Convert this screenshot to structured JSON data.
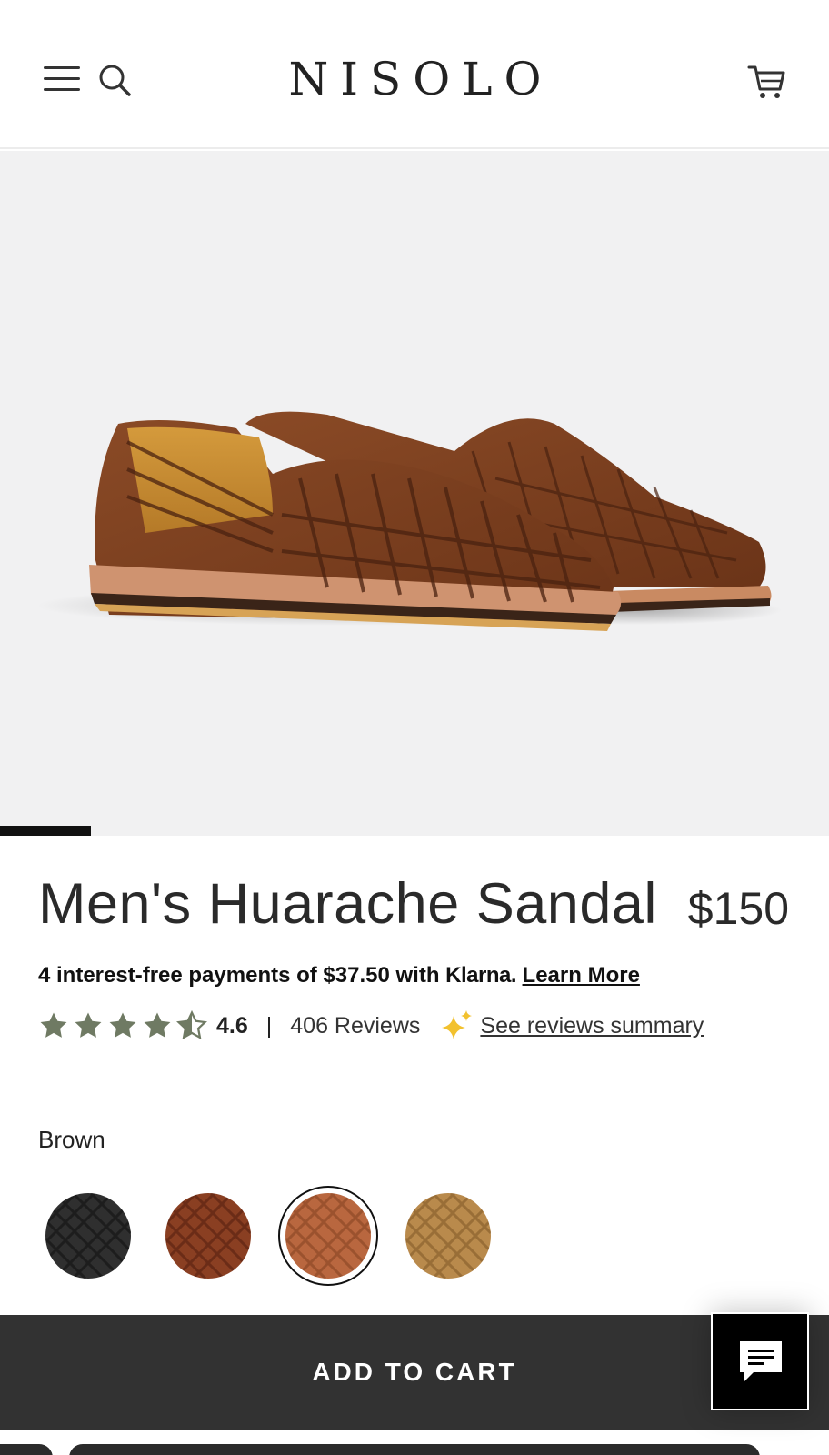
{
  "header": {
    "brand": "NISOLO",
    "menu_icon": "hamburger-menu-icon",
    "search_icon": "search-icon",
    "cart_icon": "shopping-cart-icon"
  },
  "hero": {
    "image": "huarache-sandal-pair-photo",
    "carousel_progress": 0.11
  },
  "product": {
    "title": "Men's Huarache Sandal",
    "price": "$150",
    "klarna": {
      "text": "4 interest-free payments of $37.50 with ",
      "brand": "Klarna",
      "period": ".",
      "link": "Learn More"
    },
    "rating": {
      "value": "4.6",
      "stars": 4.5,
      "separator": "|",
      "reviews": "406 Reviews",
      "summary_link": "See reviews summary",
      "star_color": "#6f7a63",
      "sparkle_color": "#f2c12e"
    },
    "color": {
      "label": "Brown",
      "swatches": [
        {
          "name": "Black",
          "color": "#2f2f2f",
          "selected": false
        },
        {
          "name": "Chestnut",
          "color": "#8a3f22",
          "selected": false
        },
        {
          "name": "Brown",
          "color": "#b9673f",
          "selected": true
        },
        {
          "name": "Tan",
          "color": "#b98a4c",
          "selected": false
        }
      ]
    }
  },
  "actions": {
    "add_to_cart": "ADD TO CART",
    "chat_icon": "chat-bubble-icon"
  }
}
